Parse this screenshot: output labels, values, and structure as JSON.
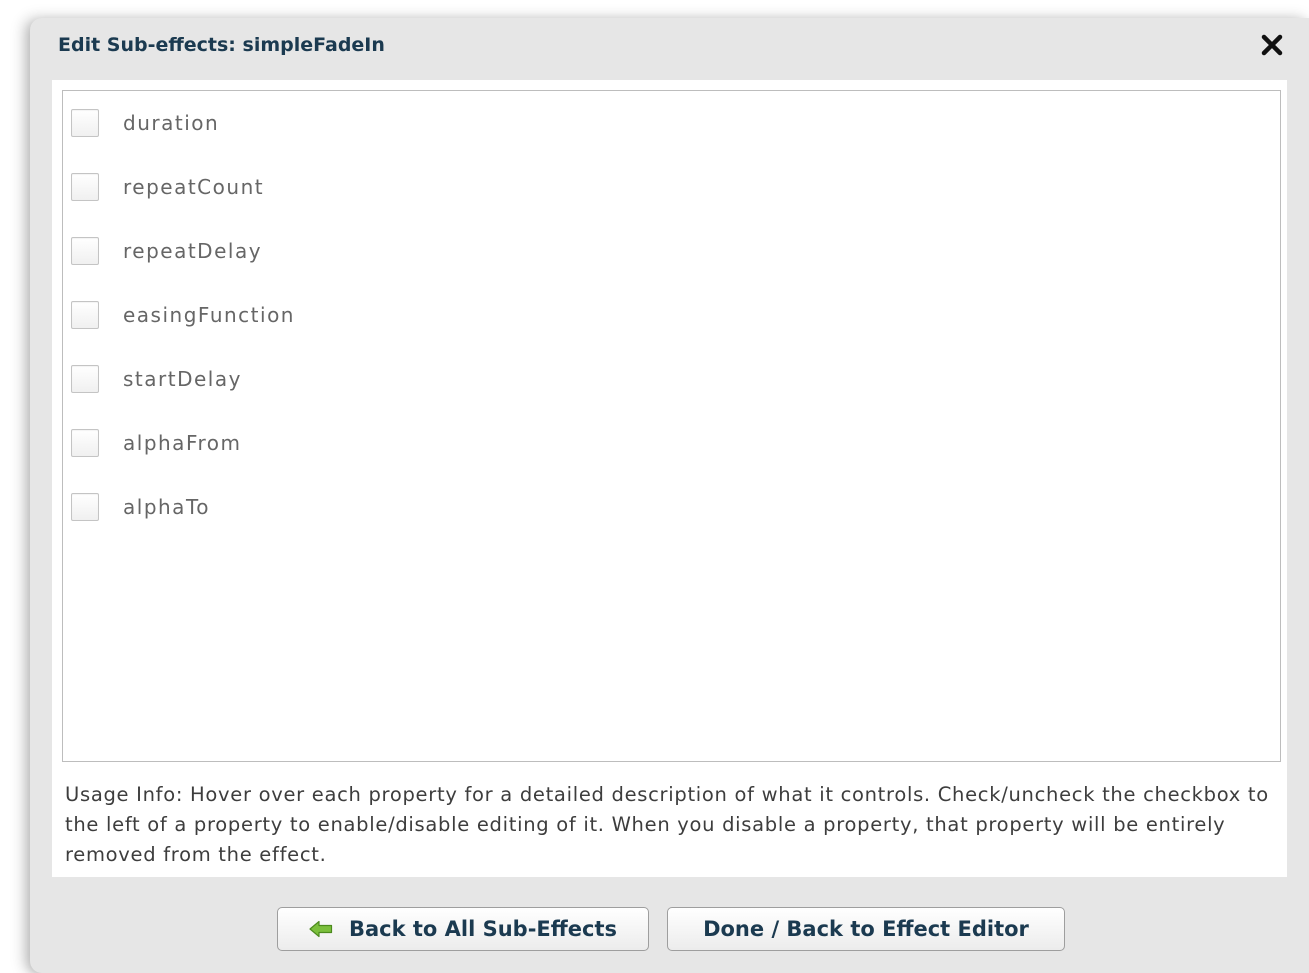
{
  "dialog": {
    "title": "Edit Sub-effects: simpleFadeIn",
    "close_icon": "close-x-icon"
  },
  "properties": [
    {
      "label": "duration",
      "checked": false
    },
    {
      "label": "repeatCount",
      "checked": false
    },
    {
      "label": "repeatDelay",
      "checked": false
    },
    {
      "label": "easingFunction",
      "checked": false
    },
    {
      "label": "startDelay",
      "checked": false
    },
    {
      "label": "alphaFrom",
      "checked": false
    },
    {
      "label": "alphaTo",
      "checked": false
    }
  ],
  "usage_info": "Usage Info: Hover over each property for a detailed description of what it controls.  Check/uncheck the checkbox to the left of a property to enable/disable editing of it.  When you disable a property, that property will be entirely removed from the effect.",
  "buttons": {
    "back_label": "Back to All Sub-Effects",
    "back_icon": "left-arrow-icon",
    "done_label": "Done / Back to Effect Editor"
  },
  "colors": {
    "title_text": "#1b3a50",
    "dialog_bg": "#e6e6e6",
    "arrow_green": "#7bbf3c"
  }
}
